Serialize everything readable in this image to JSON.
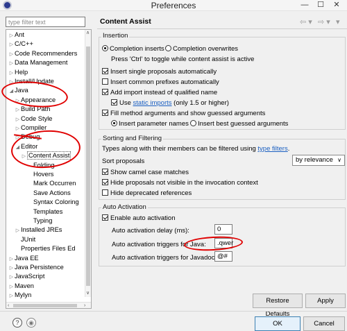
{
  "window": {
    "title": "Preferences",
    "minimize_glyph": "—",
    "maximize_glyph": "☐",
    "close_glyph": "✕"
  },
  "filter": {
    "placeholder": "type filter text"
  },
  "tree": {
    "items": [
      {
        "label": "Ant",
        "arrow": "▷"
      },
      {
        "label": "C/C++",
        "arrow": "▷"
      },
      {
        "label": "Code Recommenders",
        "arrow": "▷"
      },
      {
        "label": "Data Management",
        "arrow": "▷"
      },
      {
        "label": "Help",
        "arrow": "▷"
      },
      {
        "label": "Install/Update",
        "arrow": "▷"
      },
      {
        "label": "Java",
        "arrow": "◢"
      },
      {
        "label": "Appearance",
        "arrow": "▷"
      },
      {
        "label": "Build Path",
        "arrow": "▷"
      },
      {
        "label": "Code Style",
        "arrow": "▷"
      },
      {
        "label": "Compiler",
        "arrow": "▷"
      },
      {
        "label": "Debug",
        "arrow": "▷"
      },
      {
        "label": "Editor",
        "arrow": "◢"
      },
      {
        "label": "Content Assist",
        "arrow": "▷"
      },
      {
        "label": "Folding",
        "arrow": ""
      },
      {
        "label": "Hovers",
        "arrow": ""
      },
      {
        "label": "Mark Occurren",
        "arrow": ""
      },
      {
        "label": "Save Actions",
        "arrow": ""
      },
      {
        "label": "Syntax Coloring",
        "arrow": ""
      },
      {
        "label": "Templates",
        "arrow": ""
      },
      {
        "label": "Typing",
        "arrow": ""
      },
      {
        "label": "Installed JREs",
        "arrow": "▷"
      },
      {
        "label": "JUnit",
        "arrow": ""
      },
      {
        "label": "Properties Files Ed",
        "arrow": ""
      },
      {
        "label": "Java EE",
        "arrow": "▷"
      },
      {
        "label": "Java Persistence",
        "arrow": "▷"
      },
      {
        "label": "JavaScript",
        "arrow": "▷"
      },
      {
        "label": "Maven",
        "arrow": "▷"
      },
      {
        "label": "Mylyn",
        "arrow": "▷"
      }
    ],
    "selected": "Content Assist"
  },
  "page": {
    "title": "Content Assist",
    "nav_back": "⇦ ▾",
    "nav_forward": "⇨ ▾",
    "nav_menu": "▾"
  },
  "insertion": {
    "label": "Insertion",
    "completion_inserts": "Completion inserts",
    "completion_overwrites": "Completion overwrites",
    "toggle_hint": "Press 'Ctrl' to toggle while content assist is active",
    "insert_single": "Insert single proposals automatically",
    "insert_common": "Insert common prefixes automatically",
    "add_import": "Add import instead of qualified name",
    "use_prefix": "Use",
    "static_imports_link": "static imports",
    "static_imports_suffix": "(only 1.5 or higher)",
    "fill_args": "Fill method arguments and show guessed arguments",
    "insert_param_names": "Insert parameter names",
    "insert_best_guessed": "Insert best guessed arguments"
  },
  "sorting": {
    "label": "Sorting and Filtering",
    "types_text": "Types along with their members can be filtered using",
    "type_filters_link": "type filters",
    "types_suffix": ".",
    "sort_proposals": "Sort proposals",
    "sort_value": "by relevance",
    "show_camel": "Show camel case matches",
    "hide_not_visible": "Hide proposals not visible in the invocation context",
    "hide_deprecated": "Hide deprecated references"
  },
  "auto_activation": {
    "label": "Auto Activation",
    "enable": "Enable auto activation",
    "delay_label": "Auto activation delay (ms):",
    "delay_value": "0",
    "java_triggers_label": "Auto activation triggers for Java:",
    "java_triggers_value": ".qwer",
    "javadoc_triggers_label": "Auto activation triggers for Javadoc:",
    "javadoc_triggers_value": "@#"
  },
  "buttons": {
    "restore_defaults": "Restore Defaults",
    "apply": "Apply",
    "ok": "OK",
    "cancel": "Cancel",
    "help_glyph": "?",
    "import_glyph": "◉"
  }
}
